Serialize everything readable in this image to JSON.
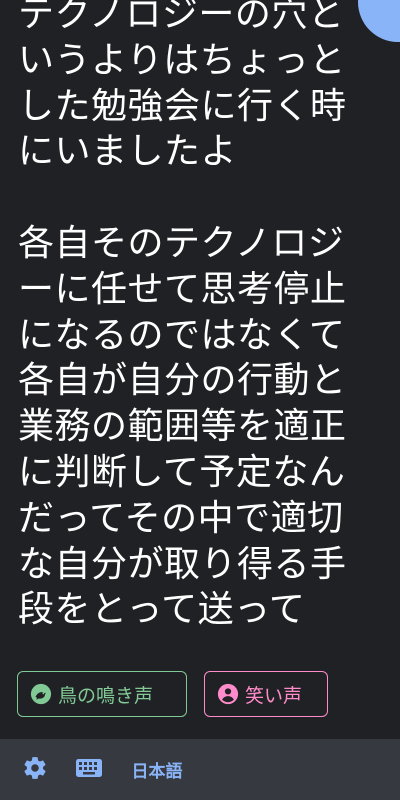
{
  "message": {
    "text": "テクノロジーの穴というよりはちょっとした勉強会に行く時にいましたよ\n\n各自そのテクノロジーに任せて思考停止になるのではなくて各自が自分の行動と業務の範囲等を適正に判断して予定なんだってその中で適切な自分が取り得る手段をとって送って"
  },
  "suggestions": [
    {
      "label": "鳥の鳴き声",
      "icon": "bird-icon",
      "color": "#81c995"
    },
    {
      "label": "笑い声",
      "icon": "person-icon",
      "color": "#ff8bcb"
    }
  ],
  "toolbar": {
    "settings_icon": "gear-icon",
    "keyboard_icon": "keyboard-icon",
    "language_label": "日本語"
  },
  "colors": {
    "background": "#202124",
    "toolbar": "#36393f",
    "accent": "#8ab4f8"
  }
}
